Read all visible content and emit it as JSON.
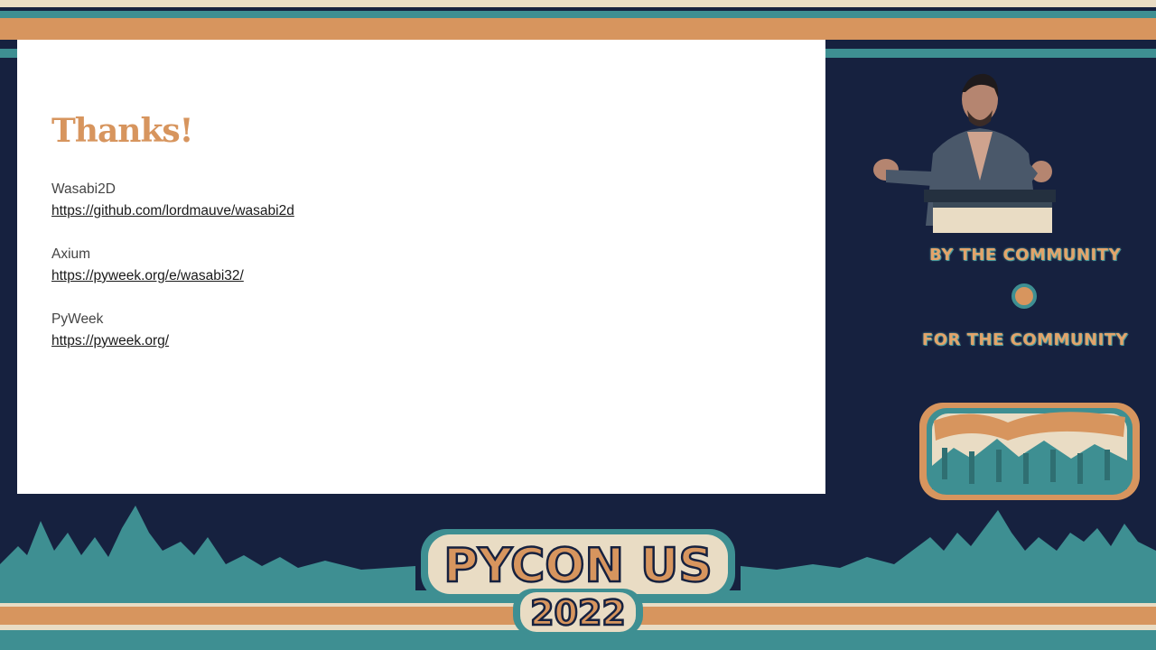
{
  "slide": {
    "title": "Thanks!",
    "entries": [
      {
        "name": "Wasabi2D",
        "url": "https://github.com/lordmauve/wasabi2d"
      },
      {
        "name": "Axium",
        "url": "https://pyweek.org/e/wasabi32/"
      },
      {
        "name": "PyWeek",
        "url": "https://pyweek.org/"
      }
    ]
  },
  "sidebar": {
    "tagline_top": "BY THE COMMUNITY",
    "tagline_bottom": "FOR THE COMMUNITY"
  },
  "event": {
    "logo_line1": "PYCON US",
    "logo_line2": "2022"
  },
  "colors": {
    "navy": "#16213f",
    "orange": "#d7955e",
    "teal": "#3e8f92",
    "cream": "#e9dcc4"
  }
}
